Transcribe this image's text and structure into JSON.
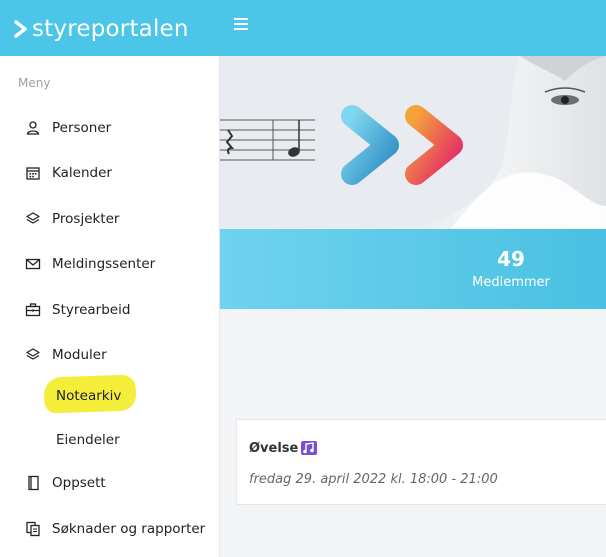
{
  "app": {
    "logo_text": "styreportalen"
  },
  "sidebar": {
    "title": "Meny",
    "items": [
      {
        "label": "Personer",
        "icon": "person-icon"
      },
      {
        "label": "Kalender",
        "icon": "calendar-icon"
      },
      {
        "label": "Prosjekter",
        "icon": "layers-icon"
      },
      {
        "label": "Meldingssenter",
        "icon": "envelope-icon"
      },
      {
        "label": "Styrearbeid",
        "icon": "briefcase-icon"
      },
      {
        "label": "Moduler",
        "icon": "layers-icon"
      }
    ],
    "subitems": [
      {
        "label": "Notearkiv"
      },
      {
        "label": "Eiendeler"
      }
    ],
    "items_after": [
      {
        "label": "Oppsett",
        "icon": "book-icon"
      },
      {
        "label": "Søknader og rapporter",
        "icon": "documents-icon"
      }
    ]
  },
  "stats": {
    "members_count": "49",
    "members_label": "Medlemmer"
  },
  "event": {
    "title": "Øvelse",
    "date": "fredag 29. april 2022 kl. 18:00 - 21:00"
  },
  "colors": {
    "topbar": "#4bc5e8",
    "highlight": "#f4ee3a",
    "accent_blue": "#3aa6d6",
    "accent_pink": "#e3276a",
    "accent_orange": "#f07a2c"
  }
}
